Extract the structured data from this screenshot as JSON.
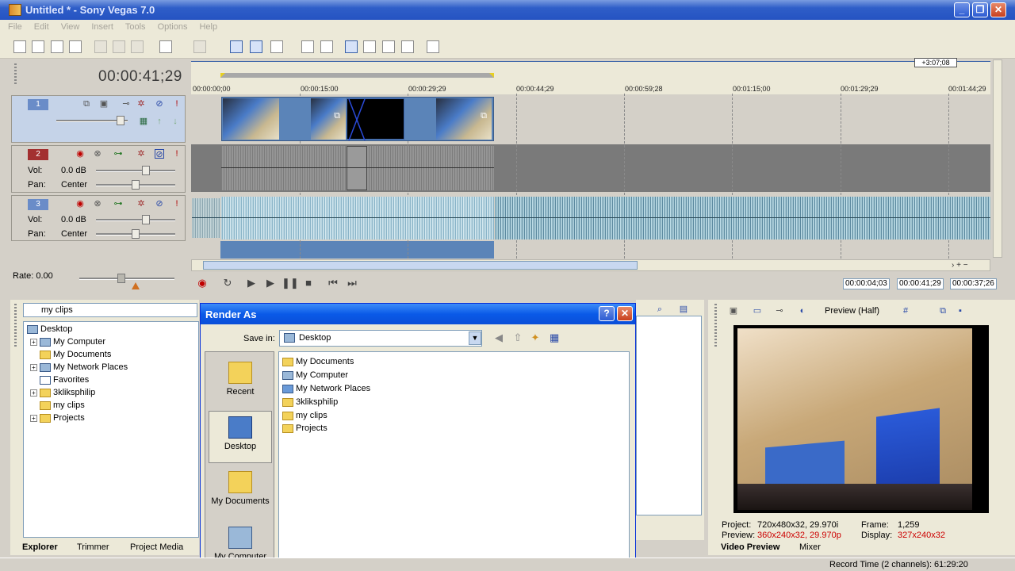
{
  "window": {
    "title": "Untitled * - Sony Vegas 7.0"
  },
  "menu": [
    "File",
    "Edit",
    "View",
    "Insert",
    "Tools",
    "Options",
    "Help"
  ],
  "timeline": {
    "cursor_time": "00:00:41;29",
    "ruler_marks": [
      "00:00:00;00",
      "00:00:15:00",
      "00:00:29;29",
      "00:00:44;29",
      "00:00:59;28",
      "00:01:15;00",
      "00:01:29;29",
      "00:01:44;29"
    ],
    "region_length": "+3:07;08",
    "tracks": [
      {
        "number": "1",
        "type": "video"
      },
      {
        "number": "2",
        "type": "audio",
        "vol_label": "Vol:",
        "vol": "0.0 dB",
        "pan_label": "Pan:",
        "pan": "Center"
      },
      {
        "number": "3",
        "type": "audio",
        "vol_label": "Vol:",
        "vol": "0.0 dB",
        "pan_label": "Pan:",
        "pan": "Center"
      }
    ],
    "rate": "Rate: 0.00",
    "selection_start": "00:00:04;03",
    "selection_end": "00:00:41;29",
    "selection_length": "00:00:37;26"
  },
  "explorer": {
    "path": "my clips",
    "tree": [
      "Desktop",
      "My Computer",
      "My Documents",
      "My Network Places",
      "Favorites",
      "3kliksphilip",
      "my clips",
      "Projects"
    ],
    "tabs": [
      "Explorer",
      "Trimmer",
      "Project Media"
    ]
  },
  "dialog": {
    "title": "Render As",
    "save_in_label": "Save in:",
    "save_in_value": "Desktop",
    "places": [
      "Recent",
      "Desktop",
      "My Documents",
      "My Computer"
    ],
    "files": [
      "My Documents",
      "My Computer",
      "My Network Places",
      "3kliksphilip",
      "my clips",
      "Projects"
    ],
    "help_btn": "?",
    "close_btn": "✕"
  },
  "preview": {
    "mode": "Preview (Half)",
    "project_label": "Project:",
    "project": "720x480x32, 29.970i",
    "preview_label": "Preview:",
    "preview": "360x240x32, 29.970p",
    "frame_label": "Frame:",
    "frame": "1,259",
    "display_label": "Display:",
    "display": "327x240x32",
    "tabs": [
      "Video Preview",
      "Mixer"
    ]
  },
  "status": {
    "record_time": "Record Time (2 channels): 61:29:20"
  },
  "colors": {
    "titlebar": "#2553c2",
    "dialog_title": "#0a5ae8",
    "track_selected": "#c5d3e8",
    "waveform": "#5d8aa0",
    "highlight_red": "#cc0000"
  }
}
